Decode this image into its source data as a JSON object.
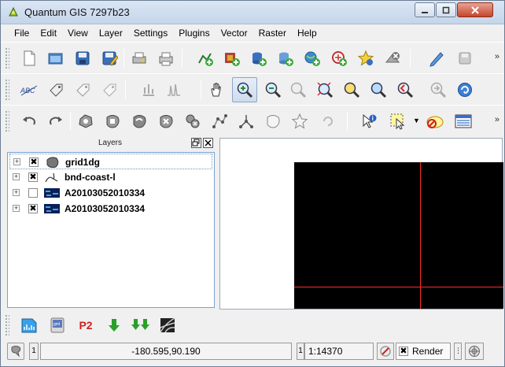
{
  "window": {
    "title": "Quantum GIS 7297b23"
  },
  "menu": [
    "File",
    "Edit",
    "View",
    "Layer",
    "Settings",
    "Plugins",
    "Vector",
    "Raster",
    "Help"
  ],
  "toolbars": {
    "file": [
      "new-project-icon",
      "open-project-icon",
      "save-project-icon",
      "save-as-icon",
      "print-composer-icon",
      "print-icon",
      "add-vector-layer-icon",
      "add-raster-layer-icon",
      "add-postgis-layer-icon",
      "add-spatialite-layer-icon",
      "add-wms-layer-icon",
      "add-wfs-layer-icon",
      "new-shapefile-icon",
      "remove-layer-icon",
      "toggle-editing-icon",
      "save-edits-icon"
    ],
    "navigation": [
      "label-icon",
      "move-label-icon",
      "rotate-label-icon",
      "change-label-icon",
      "pin-label-icon",
      "histogram-icon",
      "pan-icon",
      "zoom-in-icon",
      "zoom-out-icon",
      "zoom-full-icon",
      "zoom-to-selection-icon",
      "zoom-to-layer-icon",
      "zoom-last-icon",
      "zoom-next-icon",
      "refresh-icon"
    ],
    "digitizing": [
      "undo-icon",
      "redo-icon",
      "add-ring-icon",
      "add-part-icon",
      "fill-ring-icon",
      "delete-ring-icon",
      "delete-part-icon",
      "node-tool-icon",
      "split-features-icon",
      "merge-features-icon",
      "reshape-icon",
      "rotate-feature-icon",
      "identify-icon",
      "select-icon",
      "deselect-icon",
      "attribute-table-icon"
    ]
  },
  "layers_panel": {
    "title": "Layers",
    "layers": [
      {
        "name": "grid1dg",
        "checked": "✖",
        "icon": "polygon-layer-icon",
        "selected": true
      },
      {
        "name": "bnd-coast-l",
        "checked": "✖",
        "icon": "line-layer-icon",
        "selected": false
      },
      {
        "name": "A20103052010334",
        "checked": "",
        "icon": "raster-layer-icon",
        "selected": false
      },
      {
        "name": "A20103052010334",
        "checked": "✖",
        "icon": "raster-layer-icon",
        "selected": false
      }
    ]
  },
  "bottom_toolbar": [
    "new-raster-icon",
    "gps-icon",
    "python-icon",
    "down-arrow-icon",
    "double-down-arrow-icon",
    "grass-icon"
  ],
  "p2_label": "P2",
  "status": {
    "coordinate": "-180.595,90.190",
    "scale": "1:14370",
    "render_label": "Render",
    "render_checked": "✖"
  },
  "colors": {
    "selection_border": "#7aa2d3",
    "map_background": "#000000",
    "grid_line": "#ff2a2a"
  }
}
